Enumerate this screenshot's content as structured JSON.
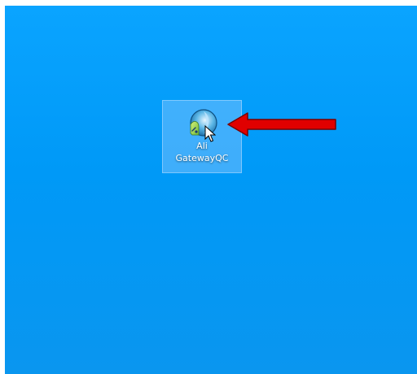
{
  "desktop": {
    "background_color": "#0a9cf5",
    "shortcut": {
      "label_line1": "Ali",
      "label_line2": "GatewayQC",
      "icon": "gatewayqc-app-icon",
      "selected": true
    }
  },
  "annotation": {
    "arrow_color": "#e00000",
    "icon": "red-pointer-arrow-icon"
  },
  "cursor": {
    "icon": "mouse-cursor-icon"
  }
}
